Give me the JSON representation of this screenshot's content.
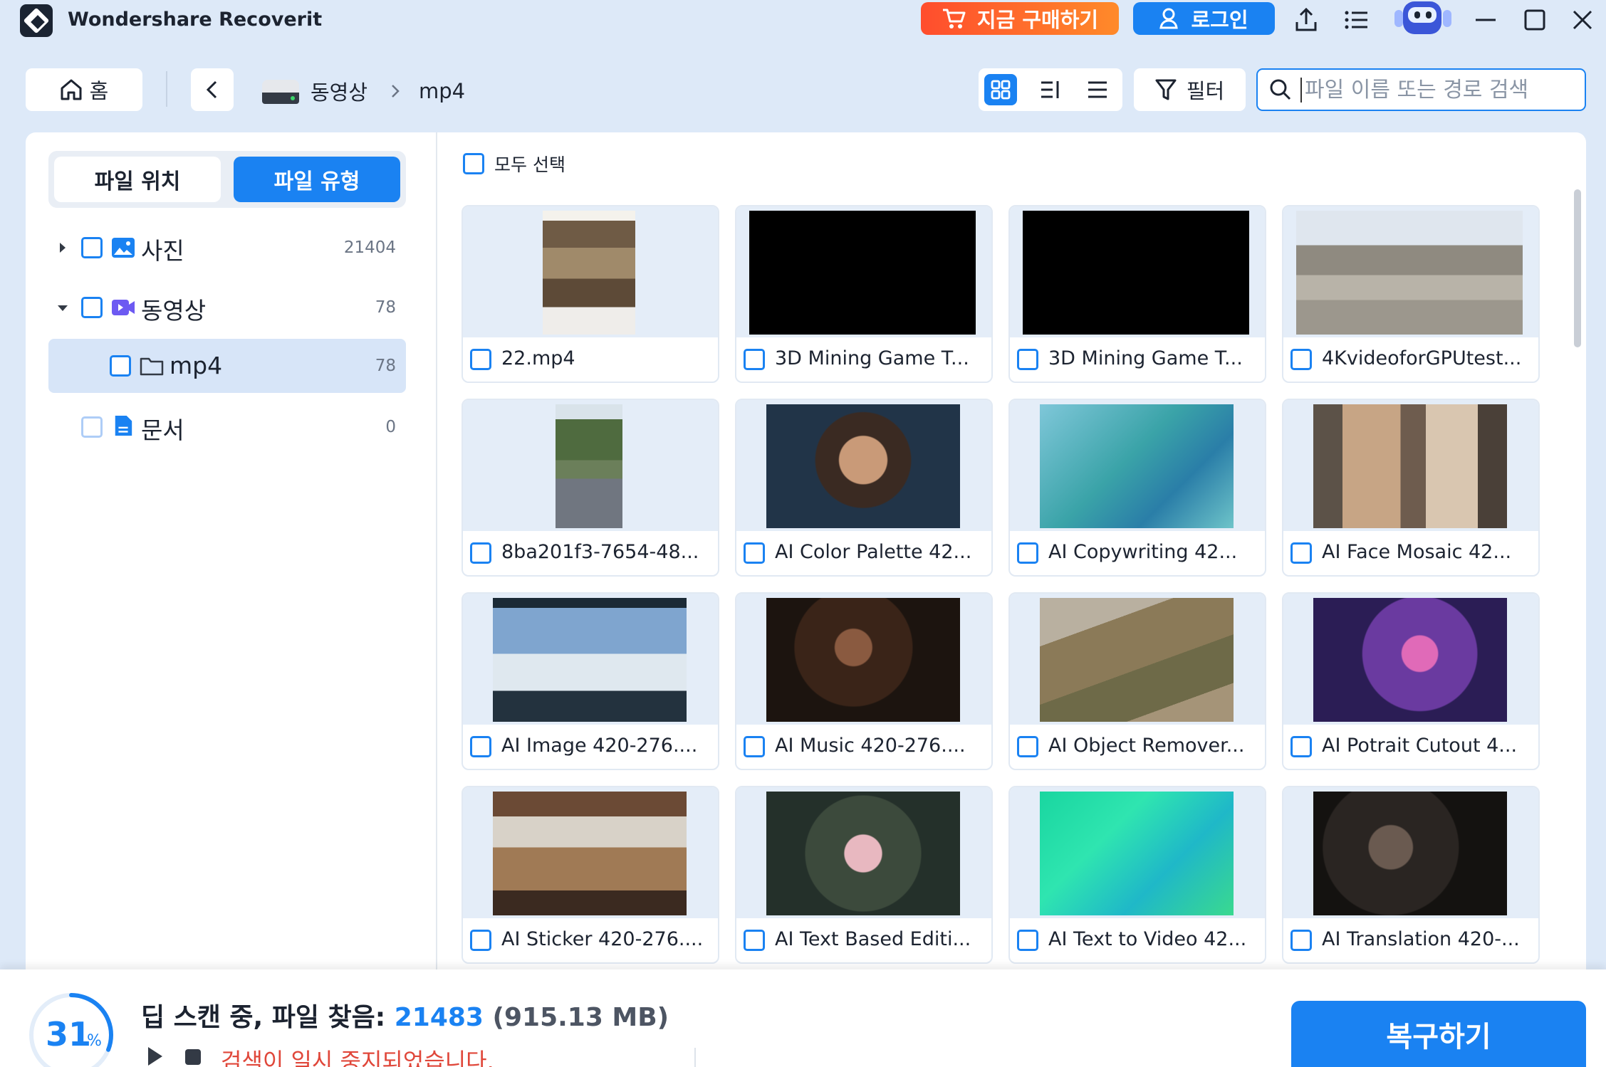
{
  "app": {
    "title": "Wondershare Recoverit"
  },
  "header": {
    "buy_label": "지금 구매하기",
    "login_label": "로그인"
  },
  "nav": {
    "home_label": "홈",
    "breadcrumb": [
      "동영상",
      "mp4"
    ],
    "filter_label": "필터",
    "search_placeholder": "파일 이름 또는 경로 검색",
    "active_view": "grid"
  },
  "sidebar": {
    "tabs": [
      {
        "label": "파일 위치",
        "active": false
      },
      {
        "label": "파일 유형",
        "active": true
      }
    ],
    "tree": [
      {
        "label": "사진",
        "count": "21404",
        "expanded": false,
        "icon": "image-icon"
      },
      {
        "label": "동영상",
        "count": "78",
        "expanded": true,
        "icon": "video-icon"
      },
      {
        "label": "mp4",
        "count": "78",
        "selected": true,
        "icon": "folder-icon"
      },
      {
        "label": "문서",
        "count": "0",
        "icon": "document-icon"
      }
    ]
  },
  "content": {
    "select_all_label": "모두 선택",
    "files": [
      {
        "name": "22.mp4"
      },
      {
        "name": "3D Mining Game T..."
      },
      {
        "name": "3D Mining Game T..."
      },
      {
        "name": "4KvideoforGPUtest..."
      },
      {
        "name": "8ba201f3-7654-48..."
      },
      {
        "name": "AI Color Palette 42..."
      },
      {
        "name": "AI Copywriting 42..."
      },
      {
        "name": "AI Face Mosaic 42..."
      },
      {
        "name": "AI Image 420-276...."
      },
      {
        "name": "AI Music 420-276...."
      },
      {
        "name": "AI Object Remover..."
      },
      {
        "name": "AI Potrait Cutout 4..."
      },
      {
        "name": "AI Sticker 420-276...."
      },
      {
        "name": "AI Text Based Editi..."
      },
      {
        "name": "AI Text to Video 42..."
      },
      {
        "name": "AI Translation 420-..."
      }
    ]
  },
  "footer": {
    "progress_value": "31",
    "progress_unit": "%",
    "progress_fraction": 0.31,
    "status_prefix": "딥 스캔 중, 파일 찾음:",
    "found_count": "21483",
    "found_size": "(915.13 MB)",
    "paused_text": "검색이 일시 중지되었습니다.",
    "recover_label": "복구하기"
  },
  "colors": {
    "accent": "#1a82f2",
    "buy_gradient_start": "#ff4d2d",
    "buy_gradient_end": "#ff8a2a",
    "warning_text": "#e0473a"
  }
}
